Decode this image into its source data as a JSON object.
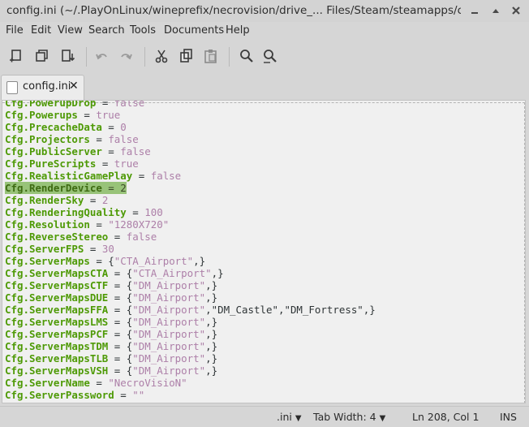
{
  "window": {
    "title": "config.ini (~/.PlayOnLinux/wineprefix/necrovision/drive_... Files/Steam/steamapps/c...",
    "controls": [
      "minimize",
      "maximize",
      "close"
    ]
  },
  "menu": [
    "File",
    "Edit",
    "View",
    "Search",
    "Tools",
    "Documents",
    "Help"
  ],
  "toolbar": {
    "icons": [
      "new-document-icon",
      "open-document-icon",
      "save-document-icon",
      "undo-icon",
      "redo-icon",
      "cut-icon",
      "copy-icon",
      "paste-icon",
      "find-icon",
      "find-replace-icon"
    ]
  },
  "tab": {
    "label": "config.ini",
    "close": "✕"
  },
  "editor": {
    "lines": [
      {
        "key": "Cfg.PowerupDrop",
        "op": " = ",
        "val": "false"
      },
      {
        "key": "Cfg.Powerups",
        "op": " = ",
        "val": "true"
      },
      {
        "key": "Cfg.PrecacheData",
        "op": " = ",
        "val": "0"
      },
      {
        "key": "Cfg.Projectors",
        "op": " = ",
        "val": "false"
      },
      {
        "key": "Cfg.PublicServer",
        "op": " = ",
        "val": "false"
      },
      {
        "key": "Cfg.PureScripts",
        "op": " = ",
        "val": "true"
      },
      {
        "key": "Cfg.RealisticGamePlay",
        "op": " = ",
        "val": "false"
      },
      {
        "key": "Cfg.RenderDevice",
        "op": " = ",
        "val": "2",
        "selected": true
      },
      {
        "key": "Cfg.RenderSky",
        "op": " = ",
        "val": "2"
      },
      {
        "key": "Cfg.RenderingQuality",
        "op": " = ",
        "val": "100"
      },
      {
        "key": "Cfg.Resolution",
        "op": " = ",
        "val": "\"1280X720\""
      },
      {
        "key": "Cfg.ReverseStereo",
        "op": " = ",
        "val": "false"
      },
      {
        "key": "Cfg.ServerFPS",
        "op": " = ",
        "val": "30"
      },
      {
        "key": "Cfg.ServerMaps",
        "op": " = {",
        "val": "\"CTA_Airport\"",
        "tail": ",}"
      },
      {
        "key": "Cfg.ServerMapsCTA",
        "op": " = {",
        "val": "\"CTA_Airport\"",
        "tail": ",}"
      },
      {
        "key": "Cfg.ServerMapsCTF",
        "op": " = {",
        "val": "\"DM_Airport\"",
        "tail": ",}"
      },
      {
        "key": "Cfg.ServerMapsDUE",
        "op": " = {",
        "val": "\"DM_Airport\"",
        "tail": ",}"
      },
      {
        "key": "Cfg.ServerMapsFFA",
        "op": " = {",
        "val": "\"DM_Airport\"",
        "tail": ",\"DM_Castle\",\"DM_Fortress\",}"
      },
      {
        "key": "Cfg.ServerMapsLMS",
        "op": " = {",
        "val": "\"DM_Airport\"",
        "tail": ",}"
      },
      {
        "key": "Cfg.ServerMapsPCF",
        "op": " = {",
        "val": "\"DM_Airport\"",
        "tail": ",}"
      },
      {
        "key": "Cfg.ServerMapsTDM",
        "op": " = {",
        "val": "\"DM_Airport\"",
        "tail": ",}"
      },
      {
        "key": "Cfg.ServerMapsTLB",
        "op": " = {",
        "val": "\"DM_Airport\"",
        "tail": ",}"
      },
      {
        "key": "Cfg.ServerMapsVSH",
        "op": " = {",
        "val": "\"DM_Airport\"",
        "tail": ",}"
      },
      {
        "key": "Cfg.ServerName",
        "op": " = ",
        "val": "\"NecroVisioN\""
      },
      {
        "key": "Cfg.ServerPassword",
        "op": " = ",
        "val": "\"\""
      }
    ]
  },
  "status": {
    "language": ".ini",
    "tab_width": "Tab Width:  4",
    "position": "Ln 208, Col 1",
    "mode": "INS"
  },
  "colors": {
    "key": "#4e9a06",
    "value": "#ad7fa8",
    "selection": "#98c379"
  }
}
